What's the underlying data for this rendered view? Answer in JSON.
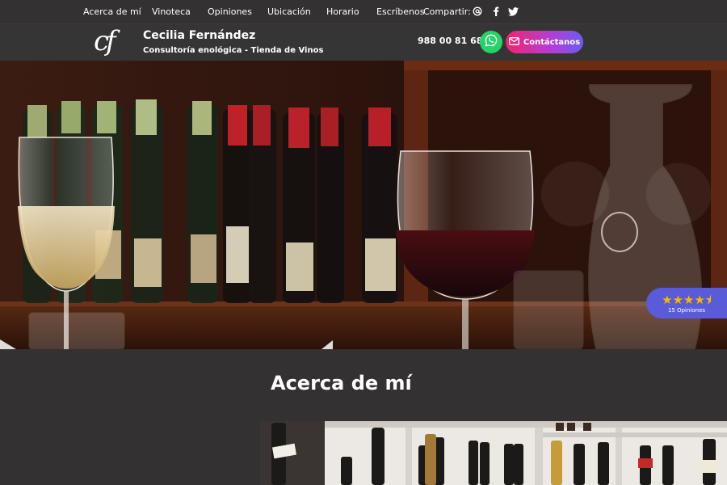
{
  "topnav": {
    "items": [
      {
        "label": "Acerca de mí"
      },
      {
        "label": "Vinoteca"
      },
      {
        "label": "Opiniones"
      },
      {
        "label": "Ubicación"
      },
      {
        "label": "Horario"
      },
      {
        "label": "Escríbenos"
      }
    ],
    "share_label": "Compartir:",
    "share_icons": [
      "at-icon",
      "facebook-icon",
      "twitter-icon"
    ]
  },
  "header": {
    "logo_text": "cf",
    "brand_name": "Cecilia Fernández",
    "brand_subtitle": "Consultoría enológica - Tienda de Vinos",
    "phone": "988 00 81 68",
    "whatsapp_icon": "whatsapp-icon",
    "contact_label": "Contáctanos",
    "contact_icon": "envelope-icon"
  },
  "rating": {
    "stars": 4.5,
    "stars_display": "★★★★⯨",
    "count_label": "15 Opiniones"
  },
  "about": {
    "title": "Acerca de mí"
  },
  "colors": {
    "background": "#333132",
    "header": "#363536",
    "whatsapp": "#25d366",
    "contact_gradient_start": "#f0256e",
    "contact_gradient_end": "#6a5cf0",
    "rating_badge": "#5a5bd8",
    "star": "#f7b800"
  }
}
